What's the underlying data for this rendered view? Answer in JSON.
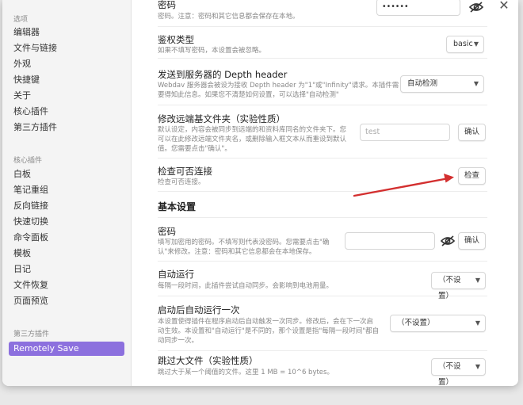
{
  "sidebar": {
    "groups": [
      "选项",
      "核心插件",
      "第三方插件"
    ],
    "options": [
      "编辑器",
      "文件与链接",
      "外观",
      "快捷键",
      "关于",
      "核心插件",
      "第三方插件"
    ],
    "core": [
      "白板",
      "笔记重组",
      "反向链接",
      "快速切换",
      "命令面板",
      "模板",
      "日记",
      "文件恢复",
      "页面预览"
    ],
    "third": [
      "Remotely Save"
    ]
  },
  "close_label": "✕",
  "webdav": {
    "password": {
      "name": "密码",
      "desc": "密码。注意：密码和其它信息都会保存在本地。",
      "value": "••••••"
    },
    "auth": {
      "name": "鉴权类型",
      "desc": "如果不填写密码，本设置会被忽略。",
      "value": "basic"
    },
    "depth": {
      "name": "发送到服务器的 Depth header",
      "desc1": "Webdav 服务器会被设为接收 Depth header 为\"1\"或\"Infinity\"请求。本插件需",
      "desc2": "要得知此信息。如果您不清楚如何设置，可以选择\"自动检测\"",
      "value": "自动检测"
    },
    "remote_dir": {
      "name": "修改远端基文件夹（实验性质）",
      "desc1": "默认设定，内容会被同步到远端的和资料库同名的文件夹下。您",
      "desc2": "可以在此修改远端文件夹名，或删除输入框文本从而重设到默认",
      "desc3": "值。您需要点击\"确认\"。",
      "placeholder": "test",
      "button": "确认"
    },
    "check": {
      "name": "检查可否连接",
      "desc": "检查可否连接。",
      "button": "检查"
    }
  },
  "basic": {
    "heading": "基本设置",
    "password": {
      "name": "密码",
      "desc1": "填写加密用的密码。不填写则代表没密码。您需要点击\"确",
      "desc2": "认\"来修改。注意：密码和其它信息都会在本地保存。",
      "button": "确认"
    },
    "auto_run": {
      "name": "自动运行",
      "desc": "每隔一段时间，此插件尝试自动同步。会影响到电池用量。",
      "value": "（不设置）"
    },
    "run_once": {
      "name": "启动后自动运行一次",
      "desc1": "本设置使得插件在程序启动后自动触发一次同步。修改后，会在下一次启",
      "desc2": "动生效。本设置和\"自动运行\"是不同的，那个设置是指\"每隔一段时间\"都自",
      "desc3": "动同步一次。",
      "value": "（不设置）"
    },
    "skip_large": {
      "name": "跳过大文件（实验性质）",
      "desc": "跳过大于某一个阈值的文件。这里 1 MB = 10^6 bytes。",
      "value": "（不设置）"
    }
  },
  "icons": {
    "eye_off": "eye-off-icon",
    "chevron": "chevron-down-icon"
  },
  "colors": {
    "accent": "#8c70de",
    "arrow": "#d32f2f"
  }
}
